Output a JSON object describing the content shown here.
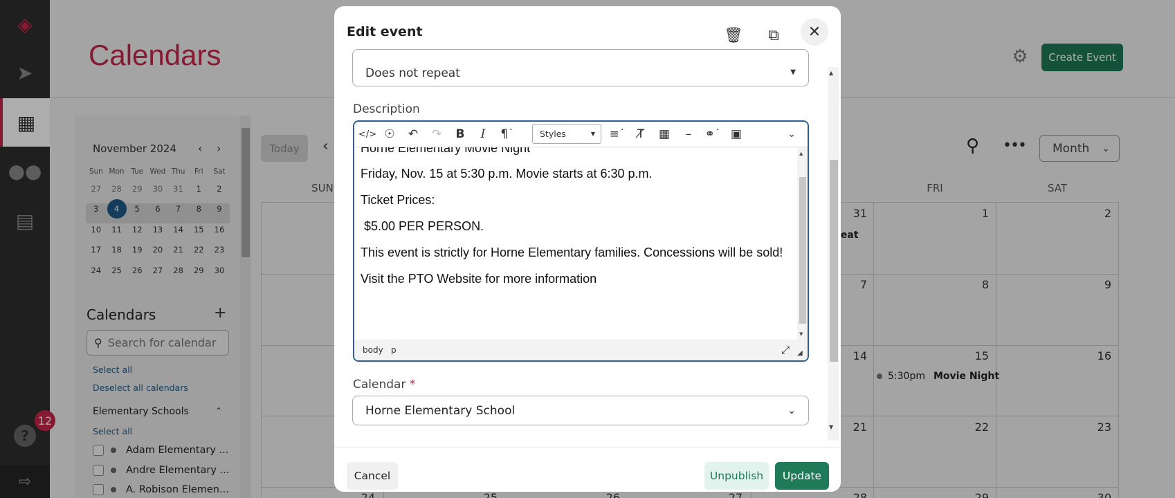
{
  "app": {
    "page_title": "Calendars",
    "create_button": "Create Event",
    "help_badge_count": "12"
  },
  "mini_calendar": {
    "month_label": "November 2024",
    "weekdays": [
      "Sun",
      "Mon",
      "Tue",
      "Wed",
      "Thu",
      "Fri",
      "Sat"
    ],
    "weeks": [
      [
        "27",
        "28",
        "29",
        "30",
        "31",
        "1",
        "2"
      ],
      [
        "3",
        "4",
        "5",
        "6",
        "7",
        "8",
        "9"
      ],
      [
        "10",
        "11",
        "12",
        "13",
        "14",
        "15",
        "16"
      ],
      [
        "17",
        "18",
        "19",
        "20",
        "21",
        "22",
        "23"
      ],
      [
        "24",
        "25",
        "26",
        "27",
        "28",
        "29",
        "30"
      ]
    ],
    "today": "4"
  },
  "calendars_panel": {
    "heading": "Calendars",
    "search_placeholder": "Search for calendar",
    "select_all": "Select all",
    "deselect_all": "Deselect all calendars",
    "group_name": "Elementary Schools",
    "group_select_all": "Select all",
    "items": [
      "Adam Elementary ...",
      "Andre Elementary ...",
      "A. Robison Elemen..."
    ]
  },
  "main_calendar": {
    "today_button": "Today",
    "view_select": "Month",
    "weekday_headers": [
      "SUN",
      "FRI",
      "SAT"
    ],
    "row1": {
      "thu": "31",
      "fri": "1",
      "sat": "2",
      "partial_event": "reat"
    },
    "row2": {
      "thu": "7",
      "fri": "8",
      "sat": "9"
    },
    "row3": {
      "thu": "14",
      "fri": "15",
      "sat": "16"
    },
    "row4": {
      "thu": "21",
      "fri": "22",
      "sat": "23"
    },
    "row5": {
      "sun": "24",
      "mon": "25",
      "tue": "26",
      "wed": "27",
      "thu": "28",
      "fri": "29",
      "sat": "30"
    },
    "event": {
      "time": "5:30pm",
      "title": "Movie Night"
    }
  },
  "modal": {
    "title": "Edit event",
    "repeat_value": "Does not repeat",
    "description_label": "Description",
    "styles_label": "Styles",
    "description_lines": [
      "Horne Elementary Movie Night",
      "Friday, Nov. 15 at 5:30 p.m. Movie starts at 6:30 p.m.",
      "Ticket Prices:",
      " $5.00 PER PERSON.",
      "This event is strictly for Horne Elementary families. Concessions will be sold!",
      "Visit the PTO Website for more information"
    ],
    "status_path": [
      "body",
      "p"
    ],
    "calendar_label": "Calendar",
    "calendar_required": "*",
    "calendar_value": "Horne Elementary School",
    "cancel": "Cancel",
    "unpublish": "Unpublish",
    "update": "Update"
  },
  "colors": {
    "brand": "#c8264b",
    "primary": "#1e7a58",
    "today": "#1d5b86",
    "rail": "#2e2e2e"
  }
}
